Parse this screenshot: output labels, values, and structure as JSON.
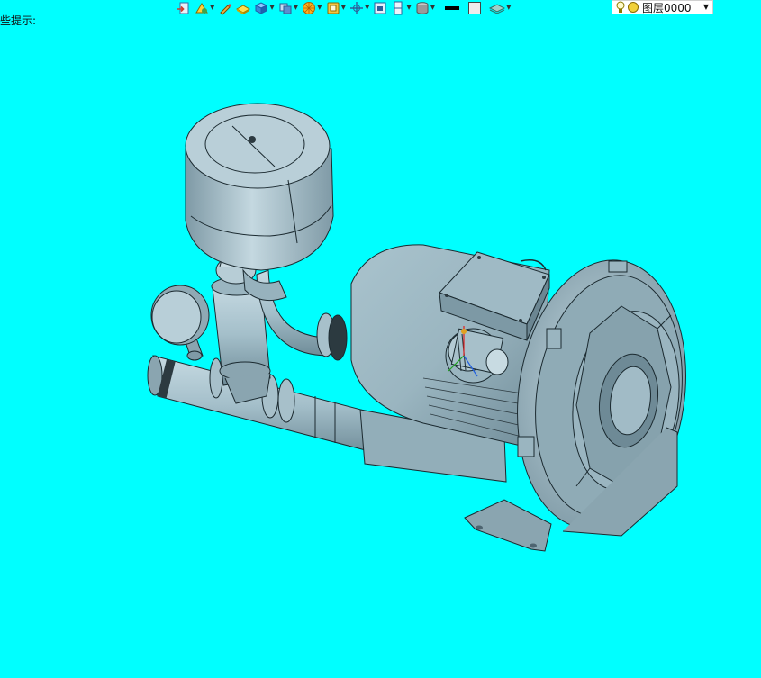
{
  "hint": {
    "text": "些提示:"
  },
  "toolbar": {
    "buttons": [
      {
        "icon": "import-icon",
        "dropdown": false
      },
      {
        "icon": "sketch-icon",
        "dropdown": true
      },
      {
        "icon": "pencil-icon",
        "dropdown": false
      },
      {
        "icon": "surface-icon",
        "dropdown": false
      },
      {
        "icon": "solid-box-icon",
        "dropdown": true
      },
      {
        "icon": "view-cube-icon",
        "dropdown": true
      },
      {
        "icon": "sun-filter-icon",
        "dropdown": true
      },
      {
        "icon": "clipboard-icon",
        "dropdown": true
      },
      {
        "icon": "axis-icon",
        "dropdown": true
      },
      {
        "icon": "frame-icon",
        "dropdown": false
      },
      {
        "icon": "section-icon",
        "dropdown": true
      },
      {
        "icon": "cylinder-icon",
        "dropdown": true
      },
      {
        "icon": "line-color-icon",
        "dropdown": false
      },
      {
        "icon": "fill-color-icon",
        "dropdown": false
      },
      {
        "icon": "layers-icon",
        "dropdown": true
      }
    ],
    "layer": {
      "value": "图层0000"
    }
  },
  "colors": {
    "background": "#00ffff",
    "model_fill": "#9fbcc8",
    "model_dark": "#6f8c98",
    "model_light": "#c6dbe3",
    "edge": "#1b2a30"
  }
}
